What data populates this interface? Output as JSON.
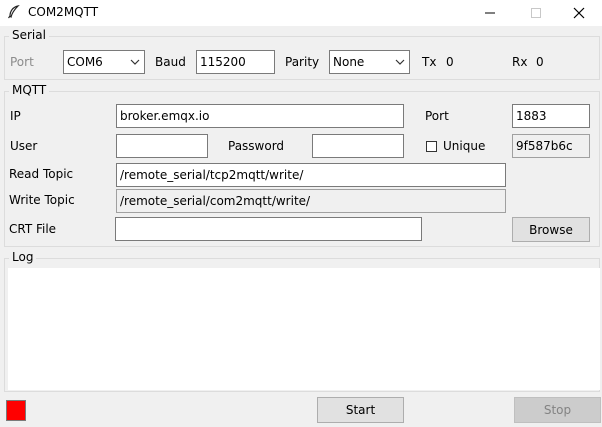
{
  "window": {
    "title": "COM2MQTT",
    "icon": "feather-icon"
  },
  "serial": {
    "group_label": "Serial",
    "port_label": "Port",
    "port_value": "COM6",
    "baud_label": "Baud",
    "baud_value": "115200",
    "parity_label": "Parity",
    "parity_value": "None",
    "tx_label": "Tx",
    "tx_value": "0",
    "rx_label": "Rx",
    "rx_value": "0"
  },
  "mqtt": {
    "group_label": "MQTT",
    "ip_label": "IP",
    "ip_value": "broker.emqx.io",
    "port_label": "Port",
    "port_value": "1883",
    "user_label": "User",
    "user_value": "",
    "password_label": "Password",
    "password_value": "",
    "unique_label": "Unique",
    "unique_checked": false,
    "client_id": "9f587b6c",
    "read_topic_label": "Read Topic",
    "read_topic_value": "/remote_serial/tcp2mqtt/write/",
    "write_topic_label": "Write Topic",
    "write_topic_value": "/remote_serial/com2mqtt/write/",
    "crt_label": "CRT File",
    "crt_value": "",
    "browse_label": "Browse"
  },
  "log": {
    "group_label": "Log",
    "content": ""
  },
  "footer": {
    "status_color": "#ff0000",
    "start_label": "Start",
    "stop_label": "Stop"
  }
}
